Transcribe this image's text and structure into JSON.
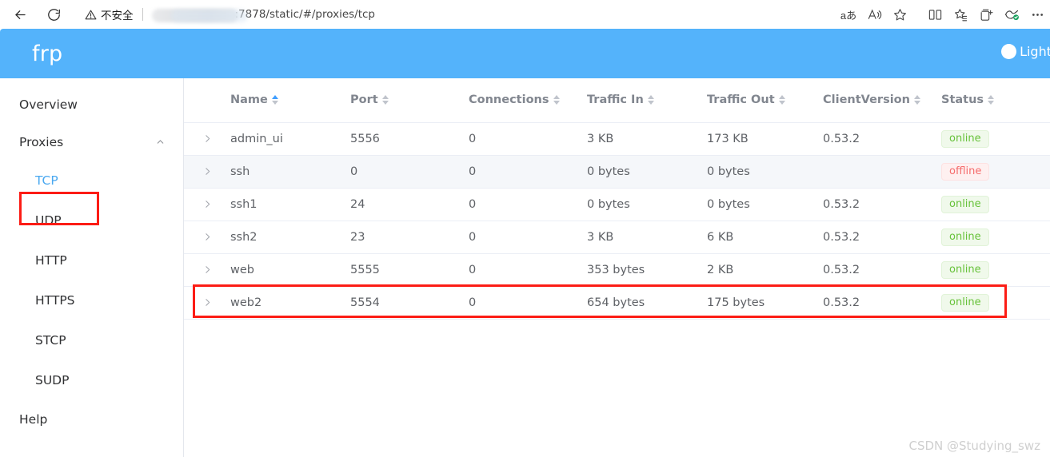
{
  "browser": {
    "back_label": "Back",
    "reload_label": "Reload",
    "security_label": "不安全",
    "url_text": ":7878/static/#/proxies/tcp",
    "actions": [
      {
        "name": "translate-icon",
        "glyph": "aあ"
      },
      {
        "name": "read-aloud-icon",
        "glyph": ""
      },
      {
        "name": "favorite-star-icon",
        "glyph": ""
      },
      {
        "name": "split-screen-icon",
        "glyph": ""
      },
      {
        "name": "collections-icon",
        "glyph": ""
      },
      {
        "name": "add-favorites-icon",
        "glyph": ""
      },
      {
        "name": "browser-essentials-icon",
        "glyph": ""
      },
      {
        "name": "more-options-icon",
        "glyph": ""
      }
    ]
  },
  "app": {
    "brand": "frp",
    "theme_toggle_label": "Light",
    "header_color": "#54b3fb"
  },
  "sidebar": {
    "overview": "Overview",
    "proxies_group": "Proxies",
    "sub_items": [
      {
        "label": "TCP",
        "active": true
      },
      {
        "label": "UDP",
        "active": false
      },
      {
        "label": "HTTP",
        "active": false
      },
      {
        "label": "HTTPS",
        "active": false
      },
      {
        "label": "STCP",
        "active": false
      },
      {
        "label": "SUDP",
        "active": false
      }
    ],
    "help": "Help"
  },
  "table": {
    "columns": [
      {
        "key": "name",
        "label": "Name",
        "sorted": "asc"
      },
      {
        "key": "port",
        "label": "Port",
        "sorted": "none"
      },
      {
        "key": "connections",
        "label": "Connections",
        "sorted": "none"
      },
      {
        "key": "traffic_in",
        "label": "Traffic In",
        "sorted": "none"
      },
      {
        "key": "traffic_out",
        "label": "Traffic Out",
        "sorted": "none"
      },
      {
        "key": "client_version",
        "label": "ClientVersion",
        "sorted": "none"
      },
      {
        "key": "status",
        "label": "Status",
        "sorted": "none"
      }
    ],
    "rows": [
      {
        "name": "admin_ui",
        "port": "5556",
        "connections": "0",
        "traffic_in": "3 KB",
        "traffic_out": "173 KB",
        "client_version": "0.53.2",
        "status": "online",
        "highlighted": false
      },
      {
        "name": "ssh",
        "port": "0",
        "connections": "0",
        "traffic_in": "0 bytes",
        "traffic_out": "0 bytes",
        "client_version": "",
        "status": "offline",
        "highlighted": false
      },
      {
        "name": "ssh1",
        "port": "24",
        "connections": "0",
        "traffic_in": "0 bytes",
        "traffic_out": "0 bytes",
        "client_version": "0.53.2",
        "status": "online",
        "highlighted": false
      },
      {
        "name": "ssh2",
        "port": "23",
        "connections": "0",
        "traffic_in": "3 KB",
        "traffic_out": "6 KB",
        "client_version": "0.53.2",
        "status": "online",
        "highlighted": false
      },
      {
        "name": "web",
        "port": "5555",
        "connections": "0",
        "traffic_in": "353 bytes",
        "traffic_out": "2 KB",
        "client_version": "0.53.2",
        "status": "online",
        "highlighted": true
      },
      {
        "name": "web2",
        "port": "5554",
        "connections": "0",
        "traffic_in": "654 bytes",
        "traffic_out": "175 bytes",
        "client_version": "0.53.2",
        "status": "online",
        "highlighted": false
      }
    ],
    "expand_icon": "chevron-right"
  },
  "annotations": {
    "color": "#fc1c15",
    "targets": [
      "sidebar-item-tcp",
      "table-row-web"
    ]
  },
  "watermark": "CSDN @Studying_swz"
}
